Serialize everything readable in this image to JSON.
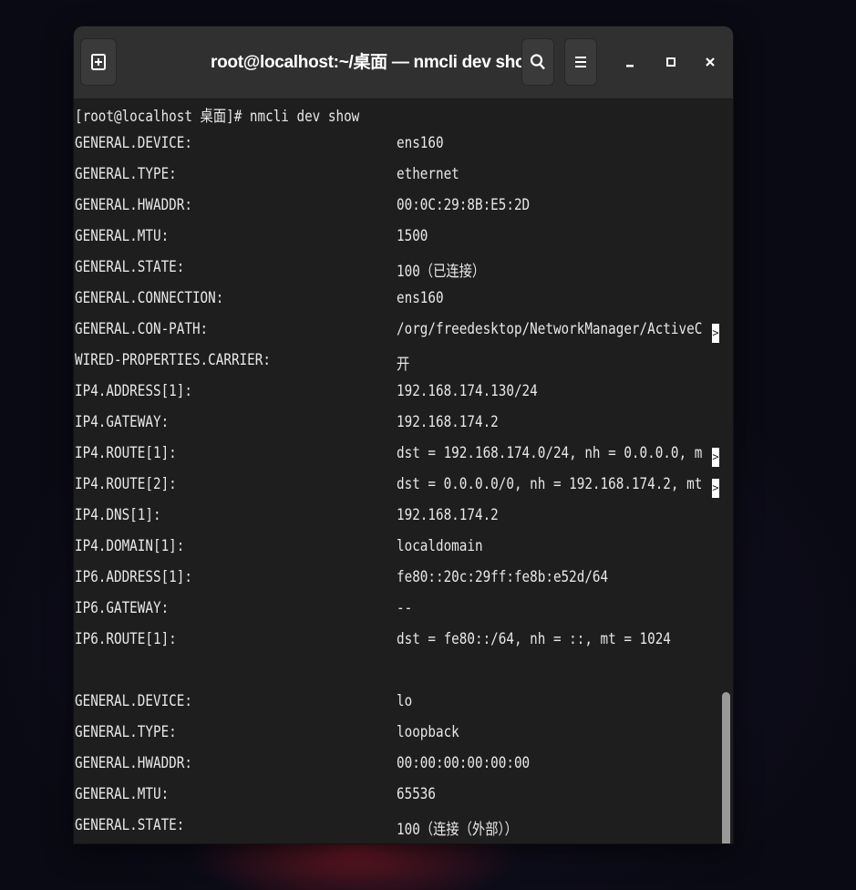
{
  "window": {
    "title": "root@localhost:~/桌面 — nmcli dev show"
  },
  "icons": {
    "new_tab": "new-tab-icon",
    "search": "search-icon",
    "menu": "hamburger-menu-icon",
    "minimize": "minimize-icon",
    "maximize": "maximize-icon",
    "close": "close-icon"
  },
  "terminal": {
    "prompt_line": "[root@localhost 桌面]# nmcli dev show",
    "rows": [
      {
        "key": "GENERAL.DEVICE:",
        "value": "ens160",
        "truncated": false
      },
      {
        "key": "GENERAL.TYPE:",
        "value": "ethernet",
        "truncated": false
      },
      {
        "key": "GENERAL.HWADDR:",
        "value": "00:0C:29:8B:E5:2D",
        "truncated": false
      },
      {
        "key": "GENERAL.MTU:",
        "value": "1500",
        "truncated": false
      },
      {
        "key": "GENERAL.STATE:",
        "value": "100（已连接）",
        "truncated": false
      },
      {
        "key": "GENERAL.CONNECTION:",
        "value": "ens160",
        "truncated": false
      },
      {
        "key": "GENERAL.CON-PATH:",
        "value": "/org/freedesktop/NetworkManager/ActiveC",
        "truncated": true
      },
      {
        "key": "WIRED-PROPERTIES.CARRIER:",
        "value": "开",
        "truncated": false
      },
      {
        "key": "IP4.ADDRESS[1]:",
        "value": "192.168.174.130/24",
        "truncated": false
      },
      {
        "key": "IP4.GATEWAY:",
        "value": "192.168.174.2",
        "truncated": false
      },
      {
        "key": "IP4.ROUTE[1]:",
        "value": "dst = 192.168.174.0/24, nh = 0.0.0.0, m",
        "truncated": true
      },
      {
        "key": "IP4.ROUTE[2]:",
        "value": "dst = 0.0.0.0/0, nh = 192.168.174.2, mt",
        "truncated": true
      },
      {
        "key": "IP4.DNS[1]:",
        "value": "192.168.174.2",
        "truncated": false
      },
      {
        "key": "IP4.DOMAIN[1]:",
        "value": "localdomain",
        "truncated": false
      },
      {
        "key": "IP6.ADDRESS[1]:",
        "value": "fe80::20c:29ff:fe8b:e52d/64",
        "truncated": false
      },
      {
        "key": "IP6.GATEWAY:",
        "value": "--",
        "truncated": false
      },
      {
        "key": "IP6.ROUTE[1]:",
        "value": "dst = fe80::/64, nh = ::, mt = 1024",
        "truncated": false
      },
      {
        "key": "",
        "value": "",
        "truncated": false
      },
      {
        "key": "GENERAL.DEVICE:",
        "value": "lo",
        "truncated": false
      },
      {
        "key": "GENERAL.TYPE:",
        "value": "loopback",
        "truncated": false
      },
      {
        "key": "GENERAL.HWADDR:",
        "value": "00:00:00:00:00:00",
        "truncated": false
      },
      {
        "key": "GENERAL.MTU:",
        "value": "65536",
        "truncated": false
      },
      {
        "key": "GENERAL.STATE:",
        "value": "100（连接（外部））",
        "truncated": false
      }
    ],
    "truncation_marker": ">"
  },
  "colors": {
    "terminal_bg": "#1e1e1e",
    "titlebar_bg": "#303030",
    "text": "#e8e8e8"
  }
}
